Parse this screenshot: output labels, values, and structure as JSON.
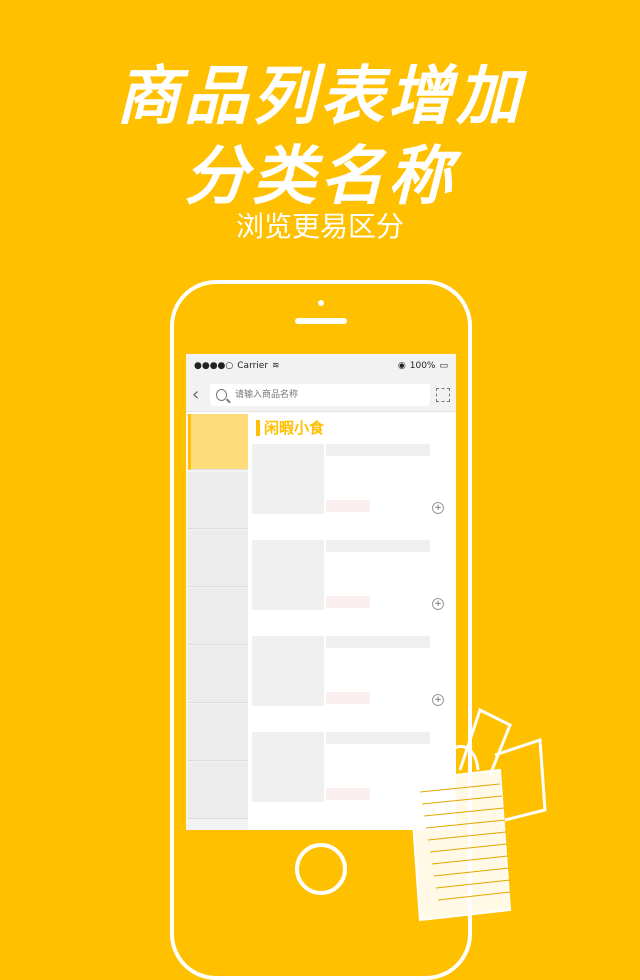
{
  "headline": {
    "line1": "商品列表增加",
    "line2": "分类名称",
    "subtitle": "浏览更易区分"
  },
  "status_bar": {
    "carrier": "Carrier",
    "battery": "100%"
  },
  "search": {
    "placeholder": "请输入商品名称"
  },
  "category": {
    "title": "闲暇小食"
  },
  "colors": {
    "accent": "#FFC000",
    "active_category": "#FFDC7A"
  },
  "icons": {
    "back": "chevron-left-icon",
    "search": "search-icon",
    "scan": "scan-icon",
    "add": "plus-icon"
  }
}
